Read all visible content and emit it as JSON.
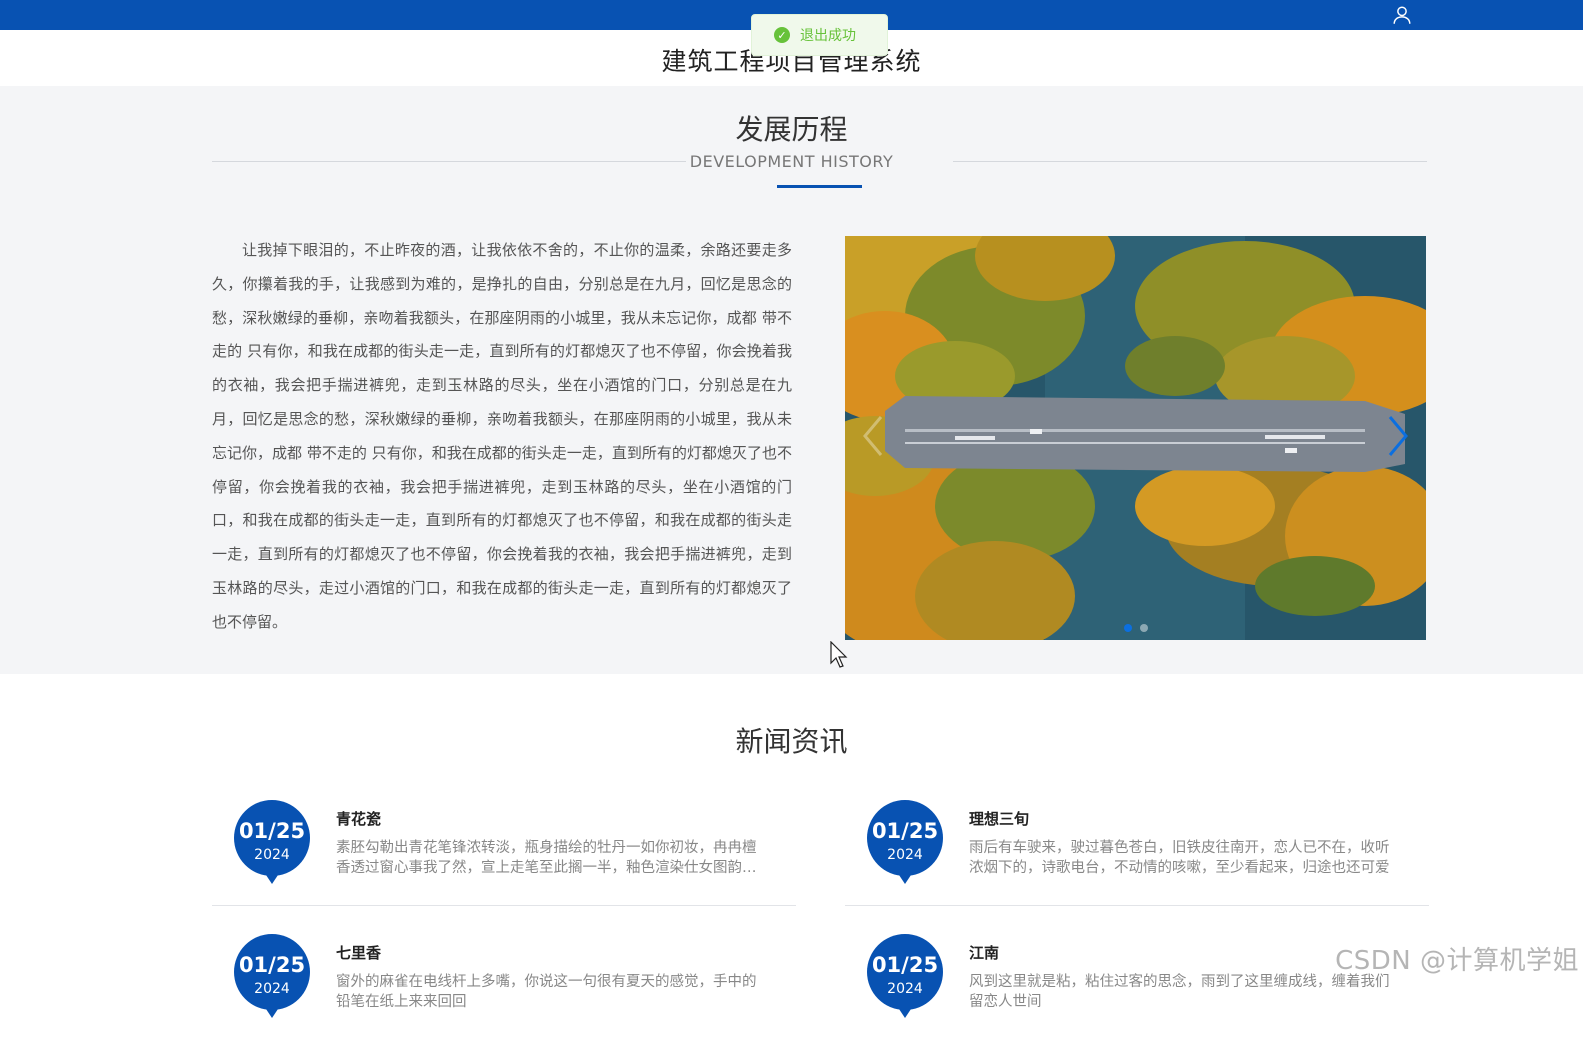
{
  "header": {
    "site_title": "建筑工程项目管理系统",
    "user_icon": "user-icon",
    "bar_color": "#0852b2"
  },
  "toast": {
    "icon": "success-check-icon",
    "message": "退出成功"
  },
  "history": {
    "title": "发展历程",
    "subtitle": "DEVELOPMENT HISTORY",
    "body": "让我掉下眼泪的，不止昨夜的酒，让我依依不舍的，不止你的温柔，余路还要走多久，你攥着我的手，让我感到为难的，是挣扎的自由，分别总是在九月，回忆是思念的愁，深秋嫩绿的垂柳，亲吻着我额头，在那座阴雨的小城里，我从未忘记你，成都 带不走的 只有你，和我在成都的街头走一走，直到所有的灯都熄灭了也不停留，你会挽着我的衣袖，我会把手揣进裤兜，走到玉林路的尽头，坐在小酒馆的门口，分别总是在九月，回忆是思念的愁，深秋嫩绿的垂柳，亲吻着我额头，在那座阴雨的小城里，我从未忘记你，成都 带不走的 只有你，和我在成都的街头走一走，直到所有的灯都熄灭了也不停留，你会挽着我的衣袖，我会把手揣进裤兜，走到玉林路的尽头，坐在小酒馆的门口，和我在成都的街头走一走，直到所有的灯都熄灭了也不停留，和我在成都的街头走一走，直到所有的灯都熄灭了也不停留，你会挽着我的衣袖，我会把手揣进裤兜，走到玉林路的尽头，走过小酒馆的门口，和我在成都的街头走一走，直到所有的灯都熄灭了也不停留。",
    "carousel": {
      "image": "aerial view of road through autumn trees over water",
      "active_index": 0,
      "slide_count": 2
    }
  },
  "news": {
    "title": "新闻资讯",
    "items": [
      {
        "month_day": "01/25",
        "year": "2024",
        "title": "青花瓷",
        "desc": "素胚勾勒出青花笔锋浓转淡，瓶身描绘的牡丹一如你初妆，冉冉檀香透过窗心事我了然，宣上走笔至此搁一半，釉色渲染仕女图韵味被私藏"
      },
      {
        "month_day": "01/25",
        "year": "2024",
        "title": "理想三旬",
        "desc": "雨后有车驶来，驶过暮色苍白，旧铁皮往南开，恋人已不在，收听浓烟下的，诗歌电台，不动情的咳嗽，至少看起来，归途也还可爱"
      },
      {
        "month_day": "01/25",
        "year": "2024",
        "title": "七里香",
        "desc": "窗外的麻雀在电线杆上多嘴，你说这一句很有夏天的感觉，手中的铅笔在纸上来来回回"
      },
      {
        "month_day": "01/25",
        "year": "2024",
        "title": "江南",
        "desc": "风到这里就是粘，粘住过客的思念，雨到了这里缠成线，缠着我们留恋人世间"
      }
    ]
  },
  "watermark": "CSDN @计算机学姐"
}
